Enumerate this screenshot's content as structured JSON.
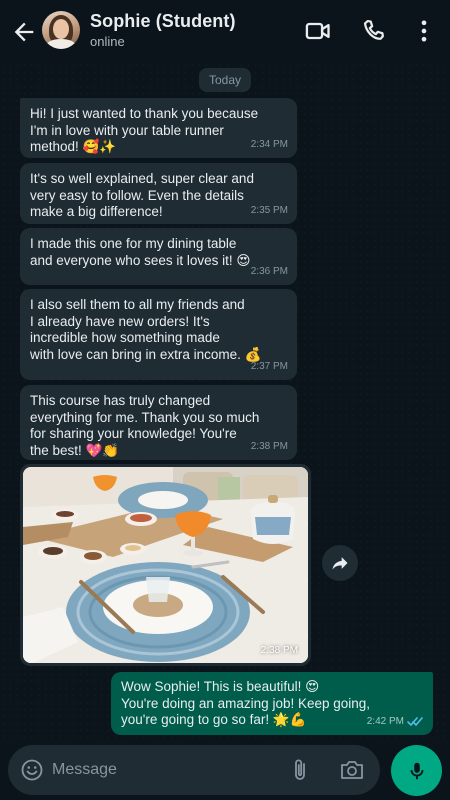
{
  "contact": {
    "name": "Sophie (Student)",
    "status": "online"
  },
  "icons": {
    "back": "arrow-left-icon",
    "video": "video-camera-icon",
    "call": "phone-icon",
    "menu": "more-vert-icon",
    "forward": "forward-icon",
    "emoji": "emoji-icon",
    "attach": "paperclip-icon",
    "camera": "camera-icon",
    "mic": "microphone-icon",
    "read": "double-check-icon"
  },
  "chat": {
    "date_label": "Today",
    "messages": [
      {
        "direction": "in",
        "text": "Hi! I just wanted to thank you because\nI'm in love with your table runner\nmethod! 🥰✨",
        "time": "2:34 PM"
      },
      {
        "direction": "in",
        "text": "It's so well explained, super clear and\nvery easy to follow. Even the details\nmake a big difference!",
        "time": "2:35 PM"
      },
      {
        "direction": "in",
        "text": "I made this one for my dining table\nand everyone who sees it loves it! 😍",
        "time": "2:36 PM"
      },
      {
        "direction": "in",
        "text": "I also sell them to all my friends and\nI already have new orders! It's\nincredible how something made\nwith love can bring in extra income. 💰",
        "time": "2:37 PM"
      },
      {
        "direction": "in",
        "text": "This course has truly changed\neverything for me. Thank you so much\nfor sharing your knowledge! You're\nthe best! 💖👏",
        "time": "2:38 PM"
      }
    ],
    "image_message": {
      "time": "2:38 PM"
    },
    "outgoing": {
      "text": "Wow Sophie! This is beautiful! 😍\nYou're doing an amazing job! Keep going,\nyou're going to go so far! 🌟💪",
      "time": "2:42 PM"
    }
  },
  "composer": {
    "placeholder": "Message"
  },
  "colors": {
    "background": "#0b141a",
    "incoming_bubble": "#1f2c34",
    "outgoing_bubble": "#005c4b",
    "accent": "#00a884",
    "read_ticks": "#53bdeb"
  }
}
